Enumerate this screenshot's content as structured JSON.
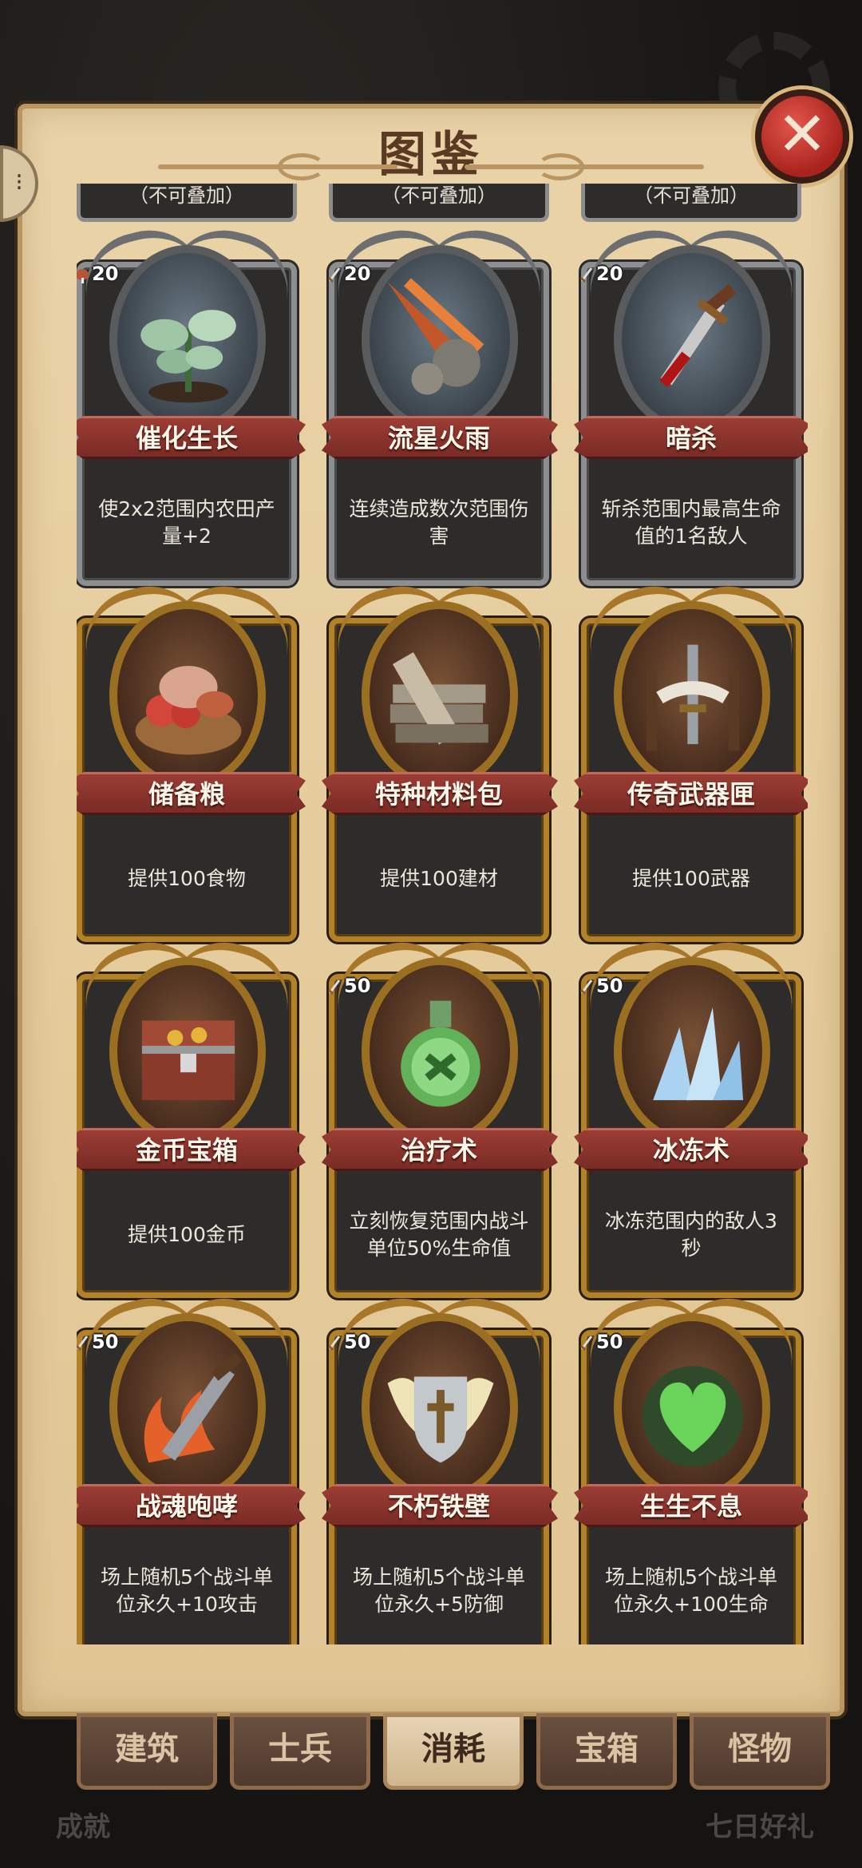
{
  "panel": {
    "title": "图鉴"
  },
  "partial_row": [
    "（不可叠加）",
    "（不可叠加）",
    "（不可叠加）"
  ],
  "rows": [
    {
      "style": "silver",
      "cards": [
        {
          "cost": "20",
          "cost_icon": "meat-icon",
          "name": "催化生长",
          "desc": "使2x2范围内农田产量+2",
          "art": "sprout-icon"
        },
        {
          "cost": "20",
          "cost_icon": "sword-icon",
          "name": "流星火雨",
          "desc": "连续造成数次范围伤害",
          "art": "meteor-icon"
        },
        {
          "cost": "20",
          "cost_icon": "sword-icon",
          "name": "暗杀",
          "desc": "斩杀范围内最高生命值的1名敌人",
          "art": "dagger-icon"
        }
      ]
    },
    {
      "style": "gold",
      "cards": [
        {
          "cost": "",
          "cost_icon": "",
          "name": "储备粮",
          "desc": "提供100食物",
          "art": "food-basket-icon"
        },
        {
          "cost": "",
          "cost_icon": "",
          "name": "特种材料包",
          "desc": "提供100建材",
          "art": "planks-icon"
        },
        {
          "cost": "",
          "cost_icon": "",
          "name": "传奇武器匣",
          "desc": "提供100武器",
          "art": "weapon-rack-icon"
        }
      ]
    },
    {
      "style": "gold",
      "cards": [
        {
          "cost": "",
          "cost_icon": "",
          "name": "金币宝箱",
          "desc": "提供100金币",
          "art": "treasure-chest-icon"
        },
        {
          "cost": "50",
          "cost_icon": "sword-icon",
          "name": "治疗术",
          "desc": "立刻恢复范围内战斗单位50%生命值",
          "art": "potion-icon"
        },
        {
          "cost": "50",
          "cost_icon": "sword-icon",
          "name": "冰冻术",
          "desc": "冰冻范围内的敌人3秒",
          "art": "ice-crystal-icon"
        }
      ]
    },
    {
      "style": "gold",
      "cards": [
        {
          "cost": "50",
          "cost_icon": "sword-icon",
          "name": "战魂咆哮",
          "desc": "场上随机5个战斗单位永久+10攻击",
          "art": "flaming-sword-icon"
        },
        {
          "cost": "50",
          "cost_icon": "sword-icon",
          "name": "不朽铁壁",
          "desc": "场上随机5个战斗单位永久+5防御",
          "art": "winged-shield-icon"
        },
        {
          "cost": "50",
          "cost_icon": "sword-icon",
          "name": "生生不息",
          "desc": "场上随机5个战斗单位永久+100生命",
          "art": "green-heart-icon"
        }
      ]
    }
  ],
  "tabs": [
    {
      "label": "建筑",
      "active": false
    },
    {
      "label": "士兵",
      "active": false
    },
    {
      "label": "消耗",
      "active": true
    },
    {
      "label": "宝箱",
      "active": false
    },
    {
      "label": "怪物",
      "active": false
    }
  ],
  "footer": {
    "left": "成就",
    "right": "七日好礼"
  },
  "colors": {
    "panel": "#e5cc9c",
    "banner": "#8a332c",
    "card": "#2e2c2a",
    "gold_frame": "#b1822a",
    "silver_frame": "#8d8e8f"
  }
}
